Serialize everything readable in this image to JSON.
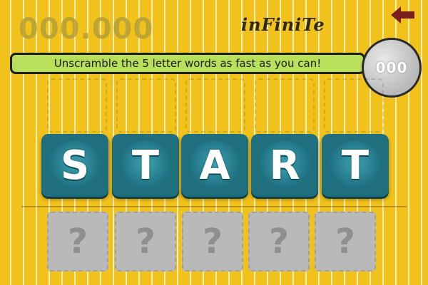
{
  "header": {
    "score": "000.000",
    "mode": "inFiniTe"
  },
  "instruction": "Unscramble the 5 letter words as fast as you can!",
  "timer": "000",
  "tiles": [
    "S",
    "T",
    "A",
    "R",
    "T"
  ],
  "placeholders": [
    "?",
    "?",
    "?",
    "?",
    "?"
  ],
  "icons": {
    "back": "back-arrow-icon"
  },
  "colors": {
    "background": "#f2c21c",
    "tile": "#1f6f7e",
    "banner": "#b8e05a",
    "placeholder": "#b9b9b9",
    "back_arrow": "#7a1f1a"
  }
}
